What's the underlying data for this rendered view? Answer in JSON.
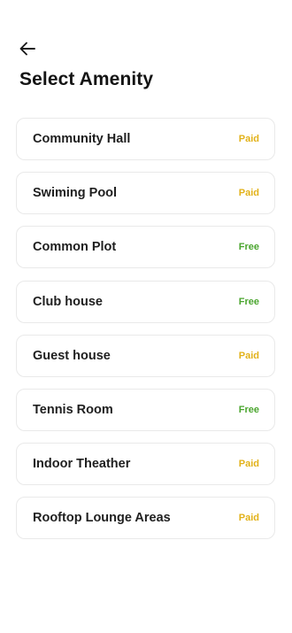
{
  "header": {
    "title": "Select Amenity",
    "back_icon": "arrow-left-icon"
  },
  "colors": {
    "paid": "#e2b21a",
    "free": "#4aa52e",
    "card_border": "#e9e9e9"
  },
  "amenities": [
    {
      "name": "Community Hall",
      "status": "Paid",
      "type": "paid"
    },
    {
      "name": "Swiming Pool",
      "status": "Paid",
      "type": "paid"
    },
    {
      "name": "Common Plot",
      "status": "Free",
      "type": "free"
    },
    {
      "name": "Club house",
      "status": "Free",
      "type": "free"
    },
    {
      "name": "Guest house",
      "status": "Paid",
      "type": "paid"
    },
    {
      "name": "Tennis Room",
      "status": "Free",
      "type": "free"
    },
    {
      "name": "Indoor Theather",
      "status": "Paid",
      "type": "paid"
    },
    {
      "name": "Rooftop Lounge Areas",
      "status": "Paid",
      "type": "paid"
    }
  ]
}
